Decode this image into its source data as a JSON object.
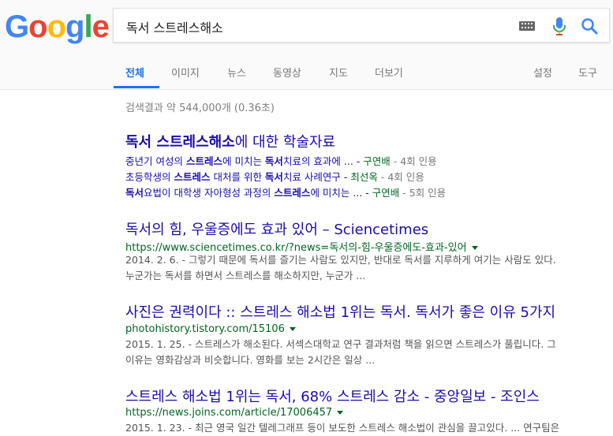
{
  "logo": {
    "letters": [
      "G",
      "o",
      "o",
      "g",
      "l",
      "e"
    ],
    "colors": [
      "#4285F4",
      "#EA4335",
      "#FBBC05",
      "#4285F4",
      "#34A853",
      "#EA4335"
    ]
  },
  "search": {
    "query": "독서 스트레스해소"
  },
  "tabs": {
    "all": "전체",
    "images": "이미지",
    "news": "뉴스",
    "videos": "동영상",
    "maps": "지도",
    "more": "더보기",
    "settings": "설정",
    "tools": "도구"
  },
  "stats": "검색결과 약 544,000개 (0.36초)",
  "scholar": {
    "title_bold": "독서 스트레스해소",
    "title_rest": "에 대한 학술자료",
    "items": [
      {
        "pre": "중년기 여성의 ",
        "b1": "스트레스",
        "mid": "에 미치는 ",
        "b2": "독서",
        "post": "치료의 효과에 ... - ",
        "author": "구연배",
        "cites": " - 4회 인용"
      },
      {
        "pre": "초등학생의 ",
        "b1": "스트레스",
        "mid": " 대처를 위한 ",
        "b2": "독서",
        "post": "치료 사례연구 - ",
        "author": "최선옥",
        "cites": " - 4회 인용"
      },
      {
        "pre": "",
        "b1": "독서",
        "mid": "요법이 대학생 자아형성 과정의 ",
        "b2": "스트레스",
        "post": "에 미치는 ... - ",
        "author": "구연배",
        "cites": " - 5회 인용"
      }
    ]
  },
  "results": [
    {
      "title": "독서의 힘, 우울증에도 효과 있어 – Sciencetimes",
      "url": "https://www.sciencetimes.co.kr/?news=독서의-힘-우울증에도-효과-있어",
      "line1": "2014. 2. 6. - 그렇기 때문에 독서를 즐기는 사람도 있지만, 반대로 독서를 지루하게 여기는 사람도 있다.",
      "line2": "누군가는 독서를 하면서 스트레스를 해소하지만, 누군가 ..."
    },
    {
      "title": "사진은 권력이다 :: 스트레스 해소법 1위는 독서. 독서가 좋은 이유 5가지",
      "url": "photohistory.tistory.com/15106",
      "line1": "2015. 1. 25. - 스트레스가 해소된다. 서섹스대학교 연구 결과처럼 책을 읽으면 스트레스가 풀립니다. 그",
      "line2": "이유는 영화감상과 비슷합니다. 영화를 보는 2시간은 일상 ..."
    },
    {
      "title": "스트레스 해소법 1위는 독서, 68% 스트레스 감소 - 중앙일보 - 조인스",
      "url": "https://news.joins.com/article/17006457",
      "line1": "2015. 1. 23. - 최근 영국 일간 텔레그래프 등이 보도한 스트레스 해소법이 관심을 끌고있다. ... 연구팀은"
    }
  ]
}
